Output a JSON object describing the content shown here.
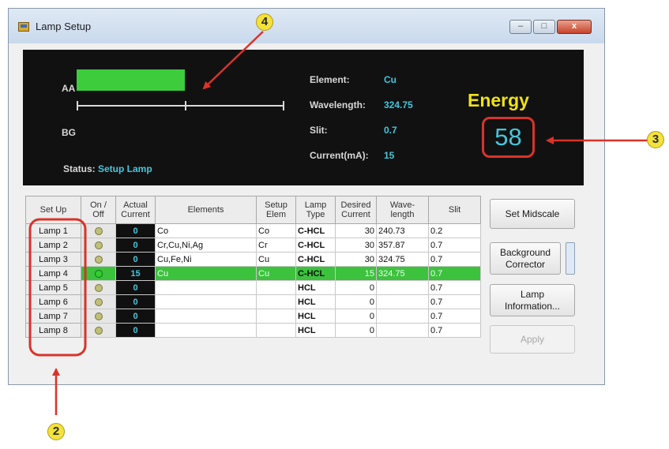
{
  "window": {
    "title": "Lamp Setup",
    "controls": [
      "–",
      "□",
      "x"
    ]
  },
  "panel": {
    "aa_label": "AA",
    "bg_label": "BG",
    "aa_energy_fraction": 0.52,
    "status_label": "Status:",
    "status_value": "Setup Lamp",
    "element_label": "Element:",
    "element_value": "Cu",
    "wavelength_label": "Wavelength:",
    "wavelength_value": "324.75",
    "slit_label": "Slit:",
    "slit_value": "0.7",
    "current_label": "Current(mA):",
    "current_value": "15",
    "energy_title": "Energy",
    "energy_value": "58"
  },
  "table": {
    "headers": {
      "setup": "Set Up",
      "onoff_1": "On /",
      "onoff_2": "Off",
      "actual_1": "Actual",
      "actual_2": "Current",
      "elements": "Elements",
      "setup_elem_1": "Setup",
      "setup_elem_2": "Elem",
      "lamp_type_1": "Lamp",
      "lamp_type_2": "Type",
      "desired_1": "Desired",
      "desired_2": "Current",
      "wave_1": "Wave-",
      "wave_2": "length",
      "slit": "Slit"
    },
    "rows": [
      {
        "lamp": "Lamp 1",
        "on": false,
        "actual": "0",
        "elements": "Co",
        "setup_elem": "Co",
        "type": "C-HCL",
        "desired": "30",
        "wavelength": "240.73",
        "slit": "0.2"
      },
      {
        "lamp": "Lamp 2",
        "on": false,
        "actual": "0",
        "elements": "Cr,Cu,Ni,Ag",
        "setup_elem": "Cr",
        "type": "C-HCL",
        "desired": "30",
        "wavelength": "357.87",
        "slit": "0.7"
      },
      {
        "lamp": "Lamp 3",
        "on": false,
        "actual": "0",
        "elements": "Cu,Fe,Ni",
        "setup_elem": "Cu",
        "type": "C-HCL",
        "desired": "30",
        "wavelength": "324.75",
        "slit": "0.7"
      },
      {
        "lamp": "Lamp 4",
        "on": true,
        "actual": "15",
        "elements": "Cu",
        "setup_elem": "Cu",
        "type": "C-HCL",
        "desired": "15",
        "wavelength": "324.75",
        "slit": "0.7"
      },
      {
        "lamp": "Lamp 5",
        "on": false,
        "actual": "0",
        "elements": "",
        "setup_elem": "",
        "type": "HCL",
        "desired": "0",
        "wavelength": "",
        "slit": "0.7"
      },
      {
        "lamp": "Lamp 6",
        "on": false,
        "actual": "0",
        "elements": "",
        "setup_elem": "",
        "type": "HCL",
        "desired": "0",
        "wavelength": "",
        "slit": "0.7"
      },
      {
        "lamp": "Lamp 7",
        "on": false,
        "actual": "0",
        "elements": "",
        "setup_elem": "",
        "type": "HCL",
        "desired": "0",
        "wavelength": "",
        "slit": "0.7"
      },
      {
        "lamp": "Lamp 8",
        "on": false,
        "actual": "0",
        "elements": "",
        "setup_elem": "",
        "type": "HCL",
        "desired": "0",
        "wavelength": "",
        "slit": "0.7"
      }
    ]
  },
  "buttons": {
    "set_midscale": "Set Midscale",
    "background_corrector_1": "Background",
    "background_corrector_2": "Corrector",
    "lamp_information_1": "Lamp",
    "lamp_information_2": "Information...",
    "apply": "Apply"
  },
  "annotations": [
    "2",
    "3",
    "4"
  ],
  "colors": {
    "panel_bg": "#111111",
    "aa_bar": "#3ccc3c",
    "value_cyan": "#46c6dc",
    "energy_yellow": "#f0e01a",
    "annotation_red": "#d9332a",
    "active_row": "#3cc23c"
  }
}
